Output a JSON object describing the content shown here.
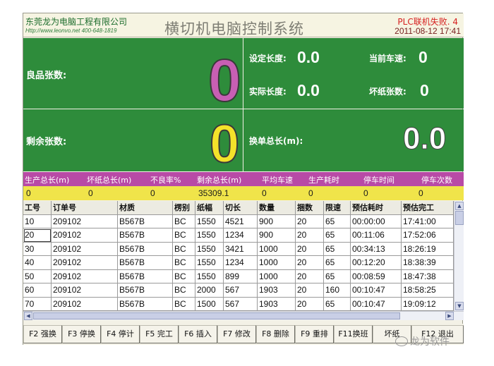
{
  "header": {
    "company": "东莞龙为电脑工程有限公司",
    "website": "Http://www.leonvo.net   400-648-1819",
    "title": "横切机电脑控制系统",
    "plc_status": "PLC联机失败.   4",
    "datetime": "2011-08-12 17:41"
  },
  "panels": {
    "good_sheets_label": "良品张数:",
    "good_sheets_value": "0",
    "set_length_label": "设定长度:",
    "set_length_value": "0.0",
    "current_speed_label": "当前车速:",
    "current_speed_value": "0",
    "actual_length_label": "实际长度:",
    "actual_length_value": "0.0",
    "bad_sheets_label": "坏纸张数:",
    "bad_sheets_value": "0",
    "remaining_label": "剩余张数:",
    "remaining_value": "0",
    "change_total_label": "换单总长(m):",
    "change_total_value": "0.0"
  },
  "stats": {
    "headers": [
      "生产总长(m)",
      "坏纸总长(m)",
      "不良率%",
      "剩余总长(m)",
      "平均车速",
      "生产耗时",
      "停车时间",
      "停车次数"
    ],
    "values": [
      "0",
      "0",
      "0",
      "35309.1",
      "0",
      "0",
      "0",
      "0"
    ]
  },
  "table": {
    "columns": [
      "工号",
      "订单号",
      "材质",
      "楞别",
      "纸幅",
      "切长",
      "数量",
      "捆数",
      "限速",
      "预估耗时",
      "预估完工"
    ],
    "rows": [
      [
        "10",
        "209102",
        "B567B",
        "BC",
        "1550",
        "4521",
        "900",
        "20",
        "65",
        "00:00:00",
        "17:41:00"
      ],
      [
        "20",
        "209102",
        "B567B",
        "BC",
        "1550",
        "1234",
        "900",
        "20",
        "65",
        "00:11:06",
        "17:52:06"
      ],
      [
        "30",
        "209102",
        "B567B",
        "BC",
        "1550",
        "3421",
        "1000",
        "20",
        "65",
        "00:34:13",
        "18:26:19"
      ],
      [
        "40",
        "209102",
        "B567B",
        "BC",
        "1550",
        "1234",
        "1000",
        "20",
        "65",
        "00:12:20",
        "18:38:39"
      ],
      [
        "50",
        "209102",
        "B567B",
        "BC",
        "1550",
        "899",
        "1000",
        "20",
        "65",
        "00:08:59",
        "18:47:38"
      ],
      [
        "60",
        "209102",
        "B567B",
        "BC",
        "2000",
        "567",
        "1903",
        "20",
        "160",
        "00:10:47",
        "18:58:25"
      ],
      [
        "70",
        "209102",
        "B567B",
        "BC",
        "1500",
        "567",
        "1903",
        "20",
        "65",
        "00:10:47",
        "19:09:12"
      ]
    ]
  },
  "function_keys": [
    "F2 强换",
    "F3 停换",
    "F4 停计",
    "F5 完工",
    "F6 插入",
    "F7 修改",
    "F8 删除",
    "F9 重排",
    "F11换班",
    "坏纸",
    "F12 退出"
  ],
  "watermark": "龙为软件",
  "icons": {
    "scroll_up": "up-arrow",
    "scroll_down": "down-arrow",
    "scroll_left": "left-arrow",
    "scroll_right": "right-arrow",
    "watermark_logo": "wechat-icon"
  },
  "colors": {
    "panel_green": "#2e8c3b",
    "good_count": "#c85fb3",
    "remaining_count": "#f4e22a",
    "stats_header": "#b84aa6",
    "stats_row": "#f0e44a",
    "plc_error": "#d62020"
  }
}
